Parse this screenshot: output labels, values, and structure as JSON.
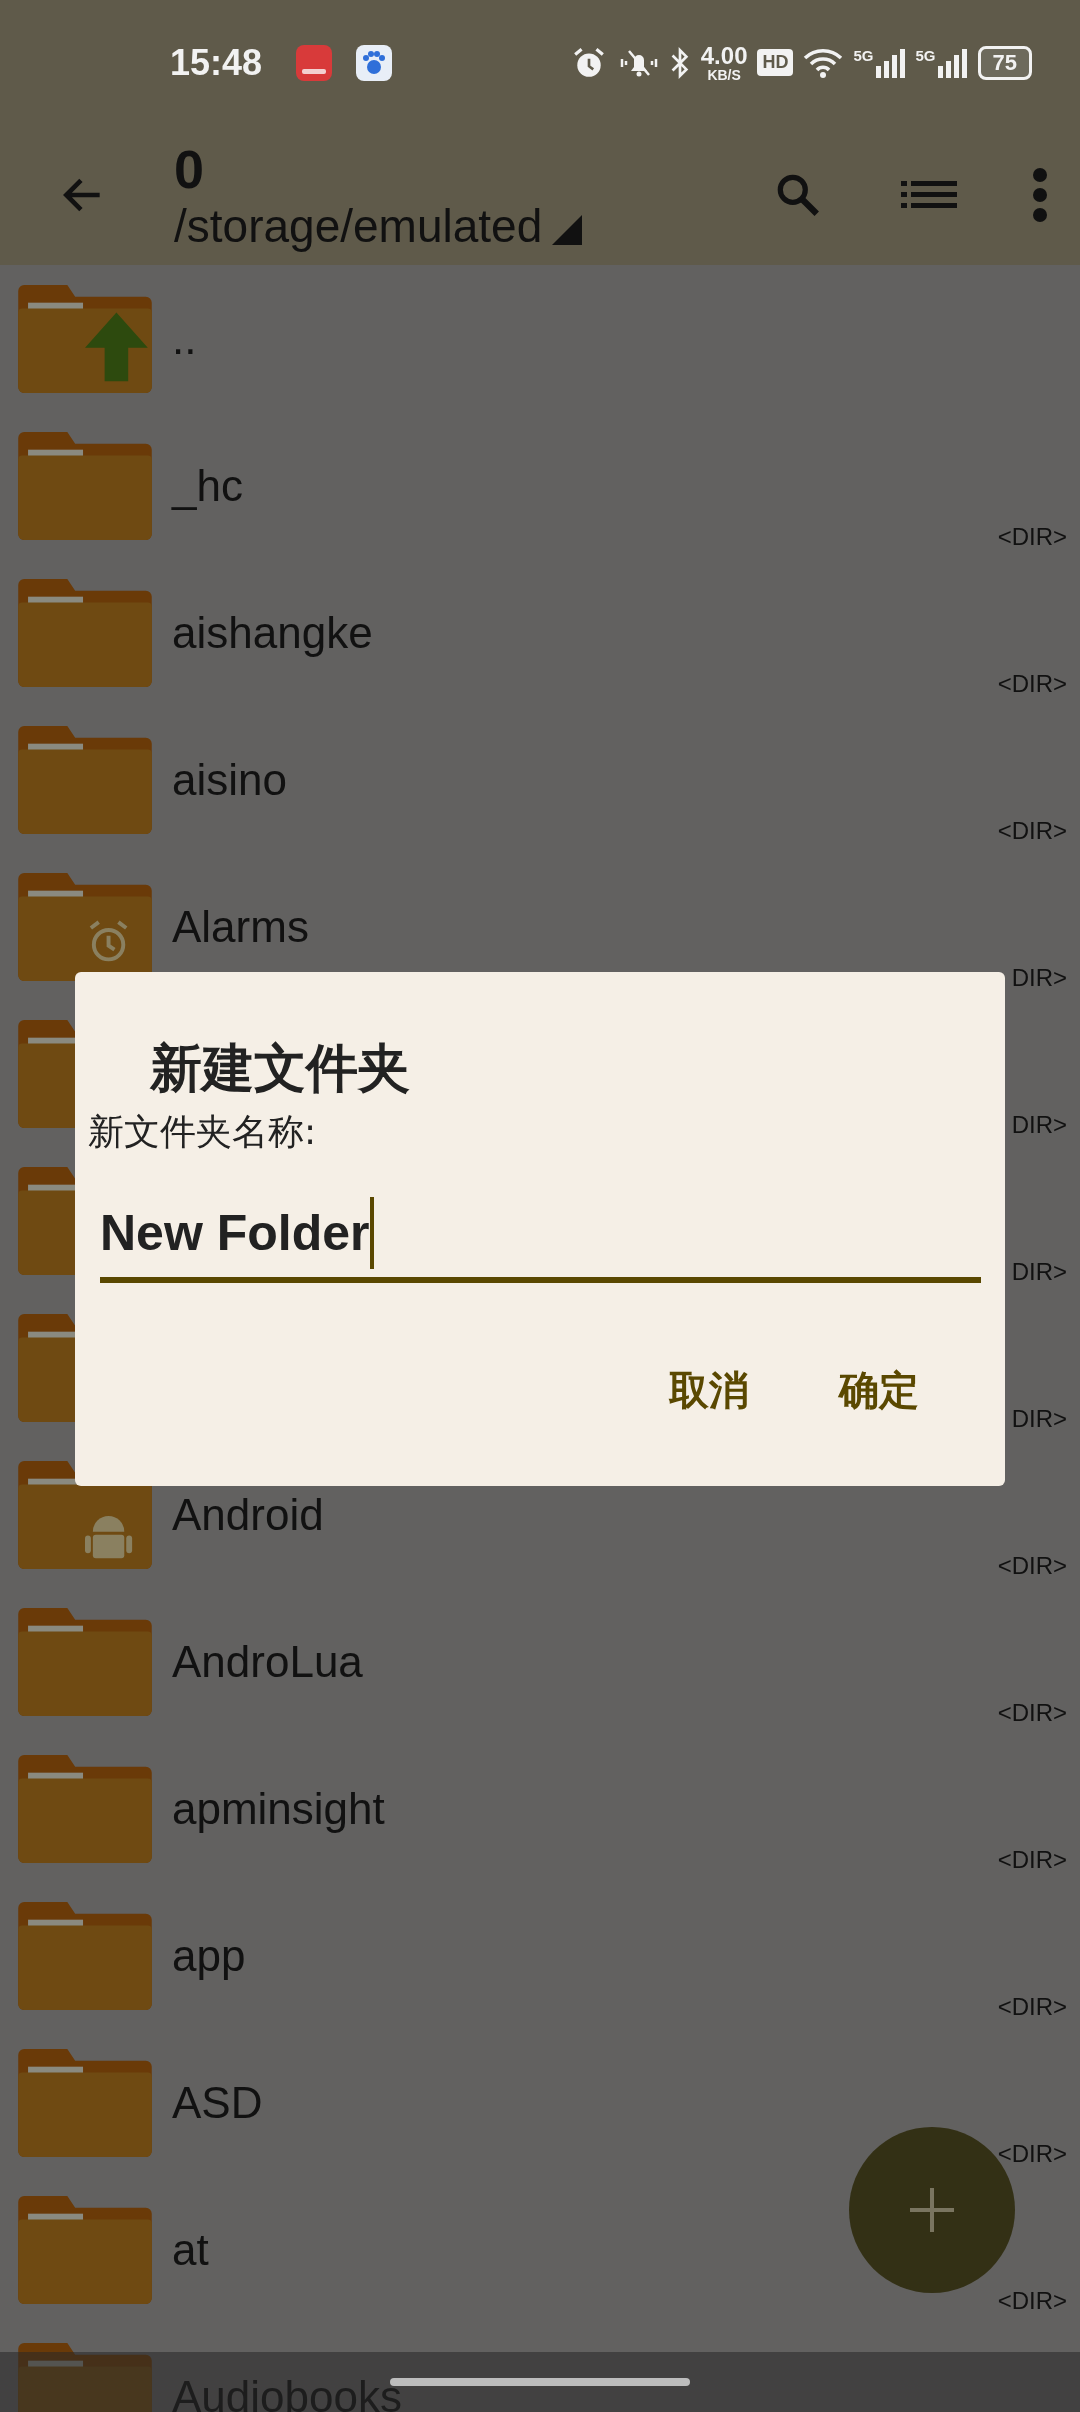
{
  "status_bar": {
    "time": "15:48",
    "notifications": [
      {
        "kind": "red-app"
      },
      {
        "kind": "paw-app"
      }
    ],
    "speed": "4.00",
    "speed_unit": "KB/S",
    "hd": "HD",
    "signals": [
      "5G",
      "5G"
    ],
    "battery": "75"
  },
  "app_bar": {
    "title": "0",
    "path": "/storage/emulated"
  },
  "files": [
    {
      "kind": "up",
      "name": ".."
    },
    {
      "kind": "folder",
      "name": "_hc",
      "tag": "<DIR>"
    },
    {
      "kind": "folder",
      "name": "aishangke",
      "tag": "<DIR>"
    },
    {
      "kind": "folder",
      "name": "aisino",
      "tag": "<DIR>"
    },
    {
      "kind": "alarm-folder",
      "name": "Alarms",
      "tag": "DIR>"
    },
    {
      "kind": "folder",
      "tag": "DIR>"
    },
    {
      "kind": "folder",
      "tag": "DIR>"
    },
    {
      "kind": "folder",
      "tag": "DIR>"
    },
    {
      "kind": "android-folder",
      "name": "Android",
      "tag": "<DIR>"
    },
    {
      "kind": "folder",
      "name": "AndroLua",
      "tag": "<DIR>"
    },
    {
      "kind": "folder",
      "name": "apminsight",
      "tag": "<DIR>"
    },
    {
      "kind": "folder",
      "name": "app",
      "tag": "<DIR>"
    },
    {
      "kind": "folder",
      "name": "ASD",
      "tag": "<DIR>"
    },
    {
      "kind": "folder",
      "name": "at",
      "tag": "<DIR>"
    },
    {
      "kind": "folder",
      "name": "Audiobooks"
    }
  ],
  "dialog": {
    "title": "新建文件夹",
    "label": "新文件夹名称:",
    "value": "New Folder",
    "buttons": [
      "取消",
      "确定"
    ]
  }
}
